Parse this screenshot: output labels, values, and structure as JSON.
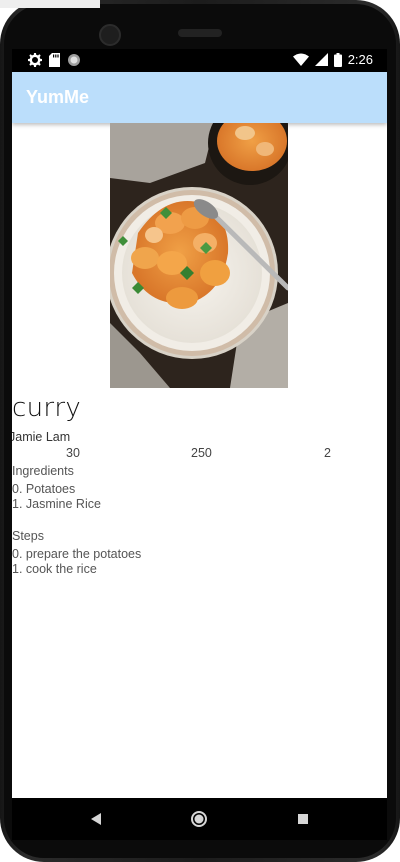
{
  "status_bar": {
    "time": "2:26",
    "left_icons": [
      "settings-icon",
      "sd-card-icon",
      "sync-circle-icon"
    ],
    "right_icons": [
      "wifi-icon",
      "cell-signal-icon",
      "battery-icon"
    ]
  },
  "app_bar": {
    "title": "YumMe"
  },
  "recipe": {
    "image": "curry-bowl-photo",
    "name": "curry",
    "author": "Jamie Lam",
    "stats": [
      "30",
      "250",
      "2"
    ],
    "ingredients_heading": "Ingredients",
    "ingredients": [
      "0. Potatoes",
      "1. Jasmine Rice"
    ],
    "steps_heading": "Steps",
    "steps": [
      "0. prepare the potatoes",
      "1. cook the rice"
    ]
  },
  "nav_bar": {
    "buttons": [
      "back-triangle-icon",
      "home-circle-icon",
      "recents-square-icon"
    ]
  },
  "colors": {
    "app_bar": "#bbdefb",
    "status_bar": "#000000",
    "background": "#ffffff"
  }
}
